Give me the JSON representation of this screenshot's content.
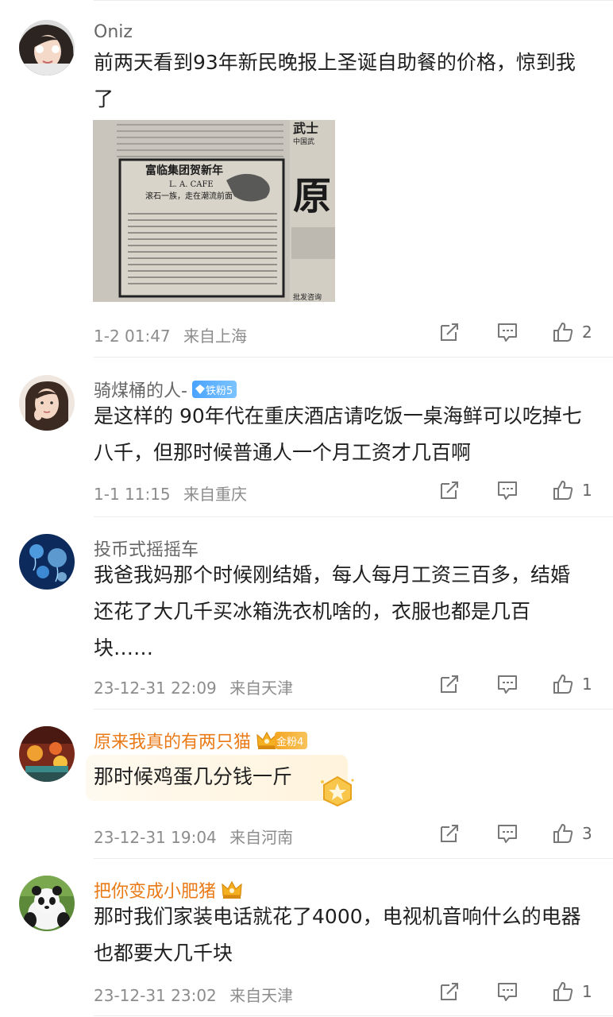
{
  "comments": [
    {
      "name": "Oniz",
      "badge": "",
      "text": "前两天看到93年新民晚报上圣诞自助餐的价格，惊到我了",
      "image": {
        "heading": "富临集团贺新年",
        "sub": "L. A. CAFE",
        "slogan": "滚石一族，走在潮流前面",
        "side_big": "原",
        "side_top": "武士",
        "side_small": "中国武",
        "side_bottom": "批发咨询"
      },
      "time": "1-2 01:47",
      "location": "来自上海",
      "likes": "2"
    },
    {
      "name": "骑煤桶的人-",
      "badge": "铁粉5",
      "text": "是这样的 90年代在重庆酒店请吃饭一桌海鲜可以吃掉七八千，但那时候普通人一个月工资才几百啊",
      "time": "1-1 11:15",
      "location": "来自重庆",
      "likes": "1"
    },
    {
      "name": "投币式摇摇车",
      "badge": "",
      "text": "我爸我妈那个时候刚结婚，每人每月工资三百多，结婚还花了大几千买冰箱洗衣机啥的，衣服也都是几百块……",
      "time": "23-12-31 22:09",
      "location": "来自天津",
      "likes": "1"
    },
    {
      "name": "原来我真的有两只猫",
      "badge": "金粉4",
      "text": "那时候鸡蛋几分钱一斤",
      "time": "23-12-31 19:04",
      "location": "来自河南",
      "likes": "3"
    },
    {
      "name": "把你变成小肥猪",
      "badge": "",
      "text": "那时我们家装电话就花了4000，电视机音响什么的电器也都要大几千块",
      "time": "23-12-31 23:02",
      "location": "来自天津",
      "likes": "1"
    }
  ],
  "icons": {
    "share": "share-icon",
    "comment": "comment-icon",
    "like": "thumbs-up-icon"
  },
  "colors": {
    "gold_name": "#ea7a16",
    "text": "#1f1f1f",
    "meta": "#8c8c8c"
  }
}
